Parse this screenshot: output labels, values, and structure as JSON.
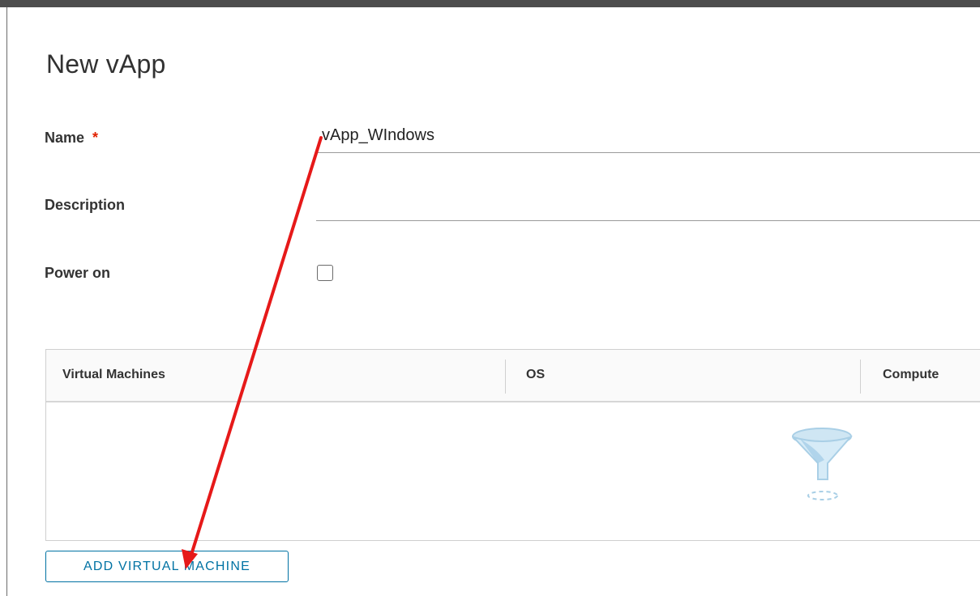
{
  "dialog": {
    "title": "New vApp"
  },
  "form": {
    "name_label": "Name",
    "required_mark": "*",
    "name_value": "vApp_WIndows",
    "description_label": "Description",
    "description_value": "",
    "power_on_label": "Power on",
    "power_on_checked": false
  },
  "vm_grid": {
    "columns": [
      "Virtual Machines",
      "OS",
      "Compute"
    ],
    "rows": [],
    "empty_icon": "funnel-filter-icon"
  },
  "actions": {
    "add_vm_label": "ADD VIRTUAL MACHINE"
  },
  "annotation": {
    "type": "red-arrow-icon",
    "color": "#e61919"
  },
  "colors": {
    "accent": "#0072a3",
    "required": "#e12200"
  }
}
